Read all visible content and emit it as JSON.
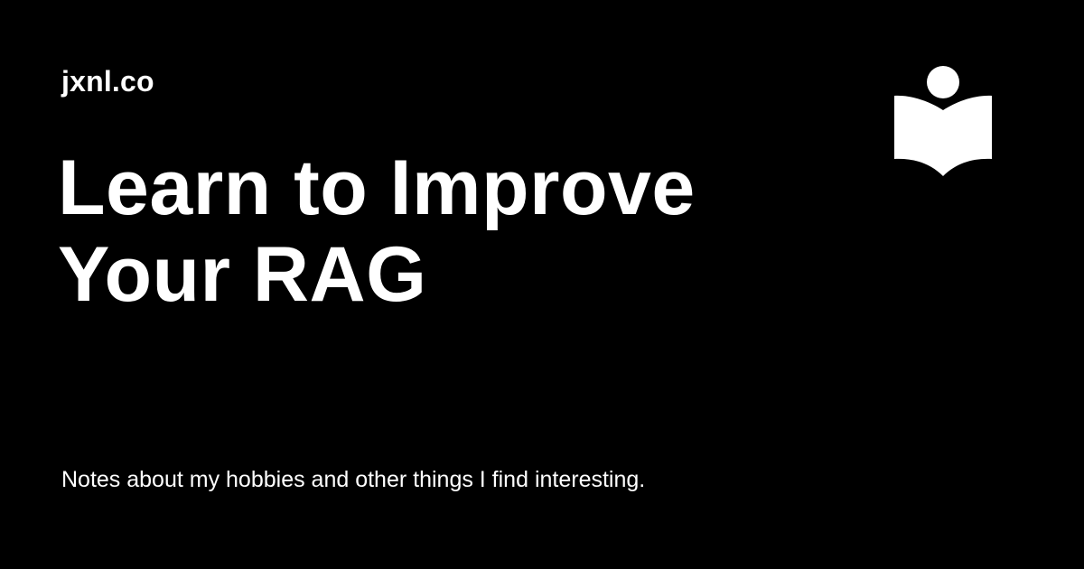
{
  "site": {
    "name": "jxnl.co"
  },
  "article": {
    "title_lines": [
      "Learn to Improve",
      "Your RAG"
    ],
    "description": "Notes about my hobbies and other things I find interesting."
  },
  "logo": {
    "icon": "reading-book-icon",
    "color": "#ffffff"
  },
  "theme": {
    "background": "#000000",
    "text": "#ffffff"
  }
}
